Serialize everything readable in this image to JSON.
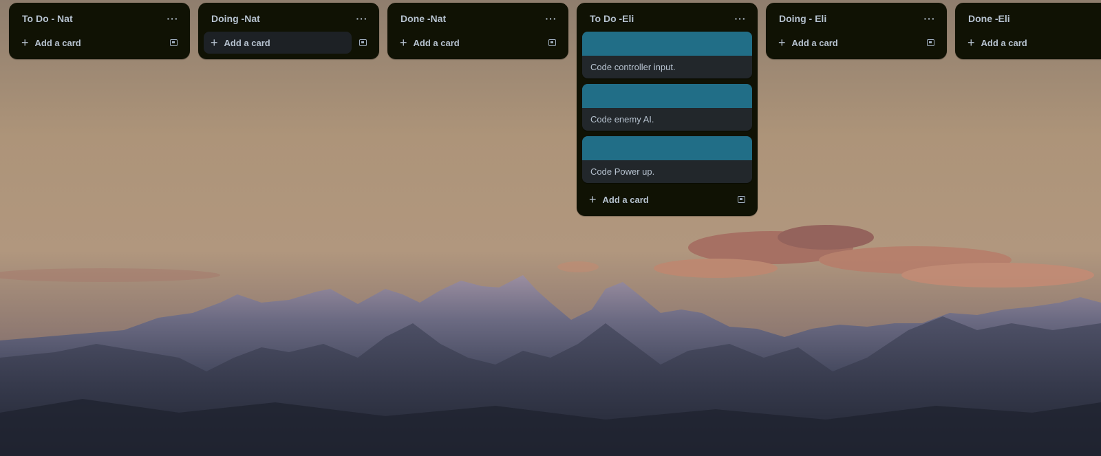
{
  "lists": [
    {
      "title": "To Do - Nat",
      "menu_label": "···",
      "add_label": "Add a card",
      "cards": []
    },
    {
      "title": "Doing -Nat",
      "menu_label": "···",
      "add_label": "Add a card",
      "cards": []
    },
    {
      "title": "Done -Nat",
      "menu_label": "···",
      "add_label": "Add a card",
      "cards": []
    },
    {
      "title": "To Do -Eli",
      "menu_label": "···",
      "add_label": "Add a card",
      "cards": [
        {
          "title": "Code controller input.",
          "cover_color": "#216e87"
        },
        {
          "title": "Code enemy AI.",
          "cover_color": "#216e87"
        },
        {
          "title": "Code Power up.",
          "cover_color": "#216e87"
        }
      ]
    },
    {
      "title": "Doing - Eli",
      "menu_label": "···",
      "add_label": "Add a card",
      "cards": []
    },
    {
      "title": "Done -Eli",
      "menu_label": "···",
      "add_label": "Add a card",
      "cards": []
    }
  ],
  "icons": {
    "add": "plus-icon",
    "template": "card-template-icon",
    "menu": "ellipsis-icon"
  },
  "colors": {
    "list_bg": "#101204",
    "card_bg": "#22272b",
    "card_cover": "#216e87",
    "text": "#b6c2cf"
  }
}
